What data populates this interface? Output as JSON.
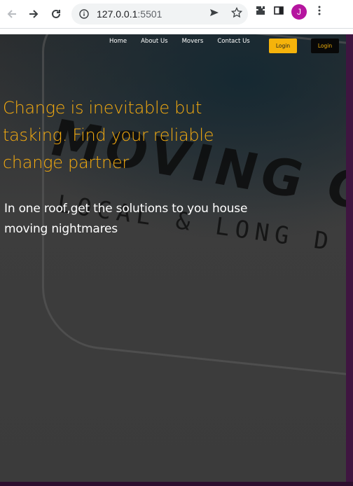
{
  "browser": {
    "url_host": "127.0.0.1",
    "url_port": ":5501",
    "profile_initial": "J"
  },
  "nav": {
    "items": [
      "Home",
      "About Us",
      "Movers",
      "Contact Us"
    ],
    "login_primary": "Login",
    "login_secondary": "Login"
  },
  "hero": {
    "headline": "Change is inevitable but tasking. Find your reliable change partner",
    "subline": "In one roof,get the solutions to you house moving nightmares"
  },
  "colors": {
    "accent": "#f6ac0f",
    "avatar": "#b5159f"
  }
}
